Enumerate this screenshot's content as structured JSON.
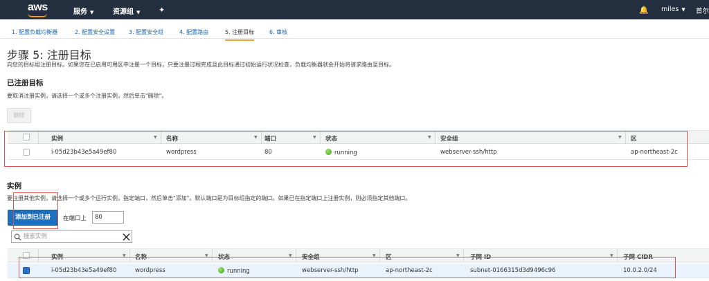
{
  "topbar": {
    "logo": "aws",
    "services": "服务",
    "resource_groups": "资源组",
    "pin_icon": "pin-icon",
    "bell_icon": "bell-icon",
    "user": "miles",
    "region": "首尔"
  },
  "steps": [
    {
      "label": "1. 配置负载均衡器"
    },
    {
      "label": "2. 配置安全设置"
    },
    {
      "label": "3. 配置安全组"
    },
    {
      "label": "4. 配置路由"
    },
    {
      "label": "5. 注册目标"
    },
    {
      "label": "6. 审核"
    }
  ],
  "page": {
    "title": "步骤 5: 注册目标",
    "description": "向您的目标组注册目标。如果您在已启用可用区中注册一个目标，只要注册过程完成且此目标通过初始运行状况检查，负载均衡器就会开始将请求路由至目标。"
  },
  "registered": {
    "heading": "已注册目标",
    "instruction": "要取消注册实例，请选择一个或多个注册实例，然后单击\"删除\"。",
    "remove_button": "删除",
    "columns": [
      "实例",
      "名称",
      "端口",
      "状态",
      "安全组",
      "区"
    ],
    "rows": [
      {
        "instance": "i-05d23b43e5a49ef80",
        "name": "wordpress",
        "port": "80",
        "status": "running",
        "security_group": "webserver-ssh/http",
        "zone": "ap-northeast-2c"
      }
    ]
  },
  "instances": {
    "heading": "实例",
    "instruction": "要注册其他实例，请选择一个或多个运行实例，指定端口，然后单击\"添加\"。默认端口是为目标组指定的端口。如果已在指定端口上注册实例，则必须指定其他端口。",
    "add_button": "添加到已注册",
    "port_label": "在端口上",
    "port_value": "80",
    "search_placeholder": "搜索实例",
    "columns": [
      "实例",
      "名称",
      "状态",
      "安全组",
      "区",
      "子网 ID",
      "子网 CIDR"
    ],
    "rows": [
      {
        "instance": "i-05d23b43e5a49ef80",
        "name": "wordpress",
        "status": "running",
        "security_group": "webserver-ssh/http",
        "zone": "ap-northeast-2c",
        "subnet_id": "subnet-0166315d3d9496c96",
        "subnet_cidr": "10.0.2.0/24",
        "checked": true
      }
    ]
  },
  "colors": {
    "topbar": "#232f3e",
    "accent": "#f90",
    "primary_button": "#1f6fbf",
    "highlight_box": "#d9534f",
    "link": "#1866b0"
  }
}
